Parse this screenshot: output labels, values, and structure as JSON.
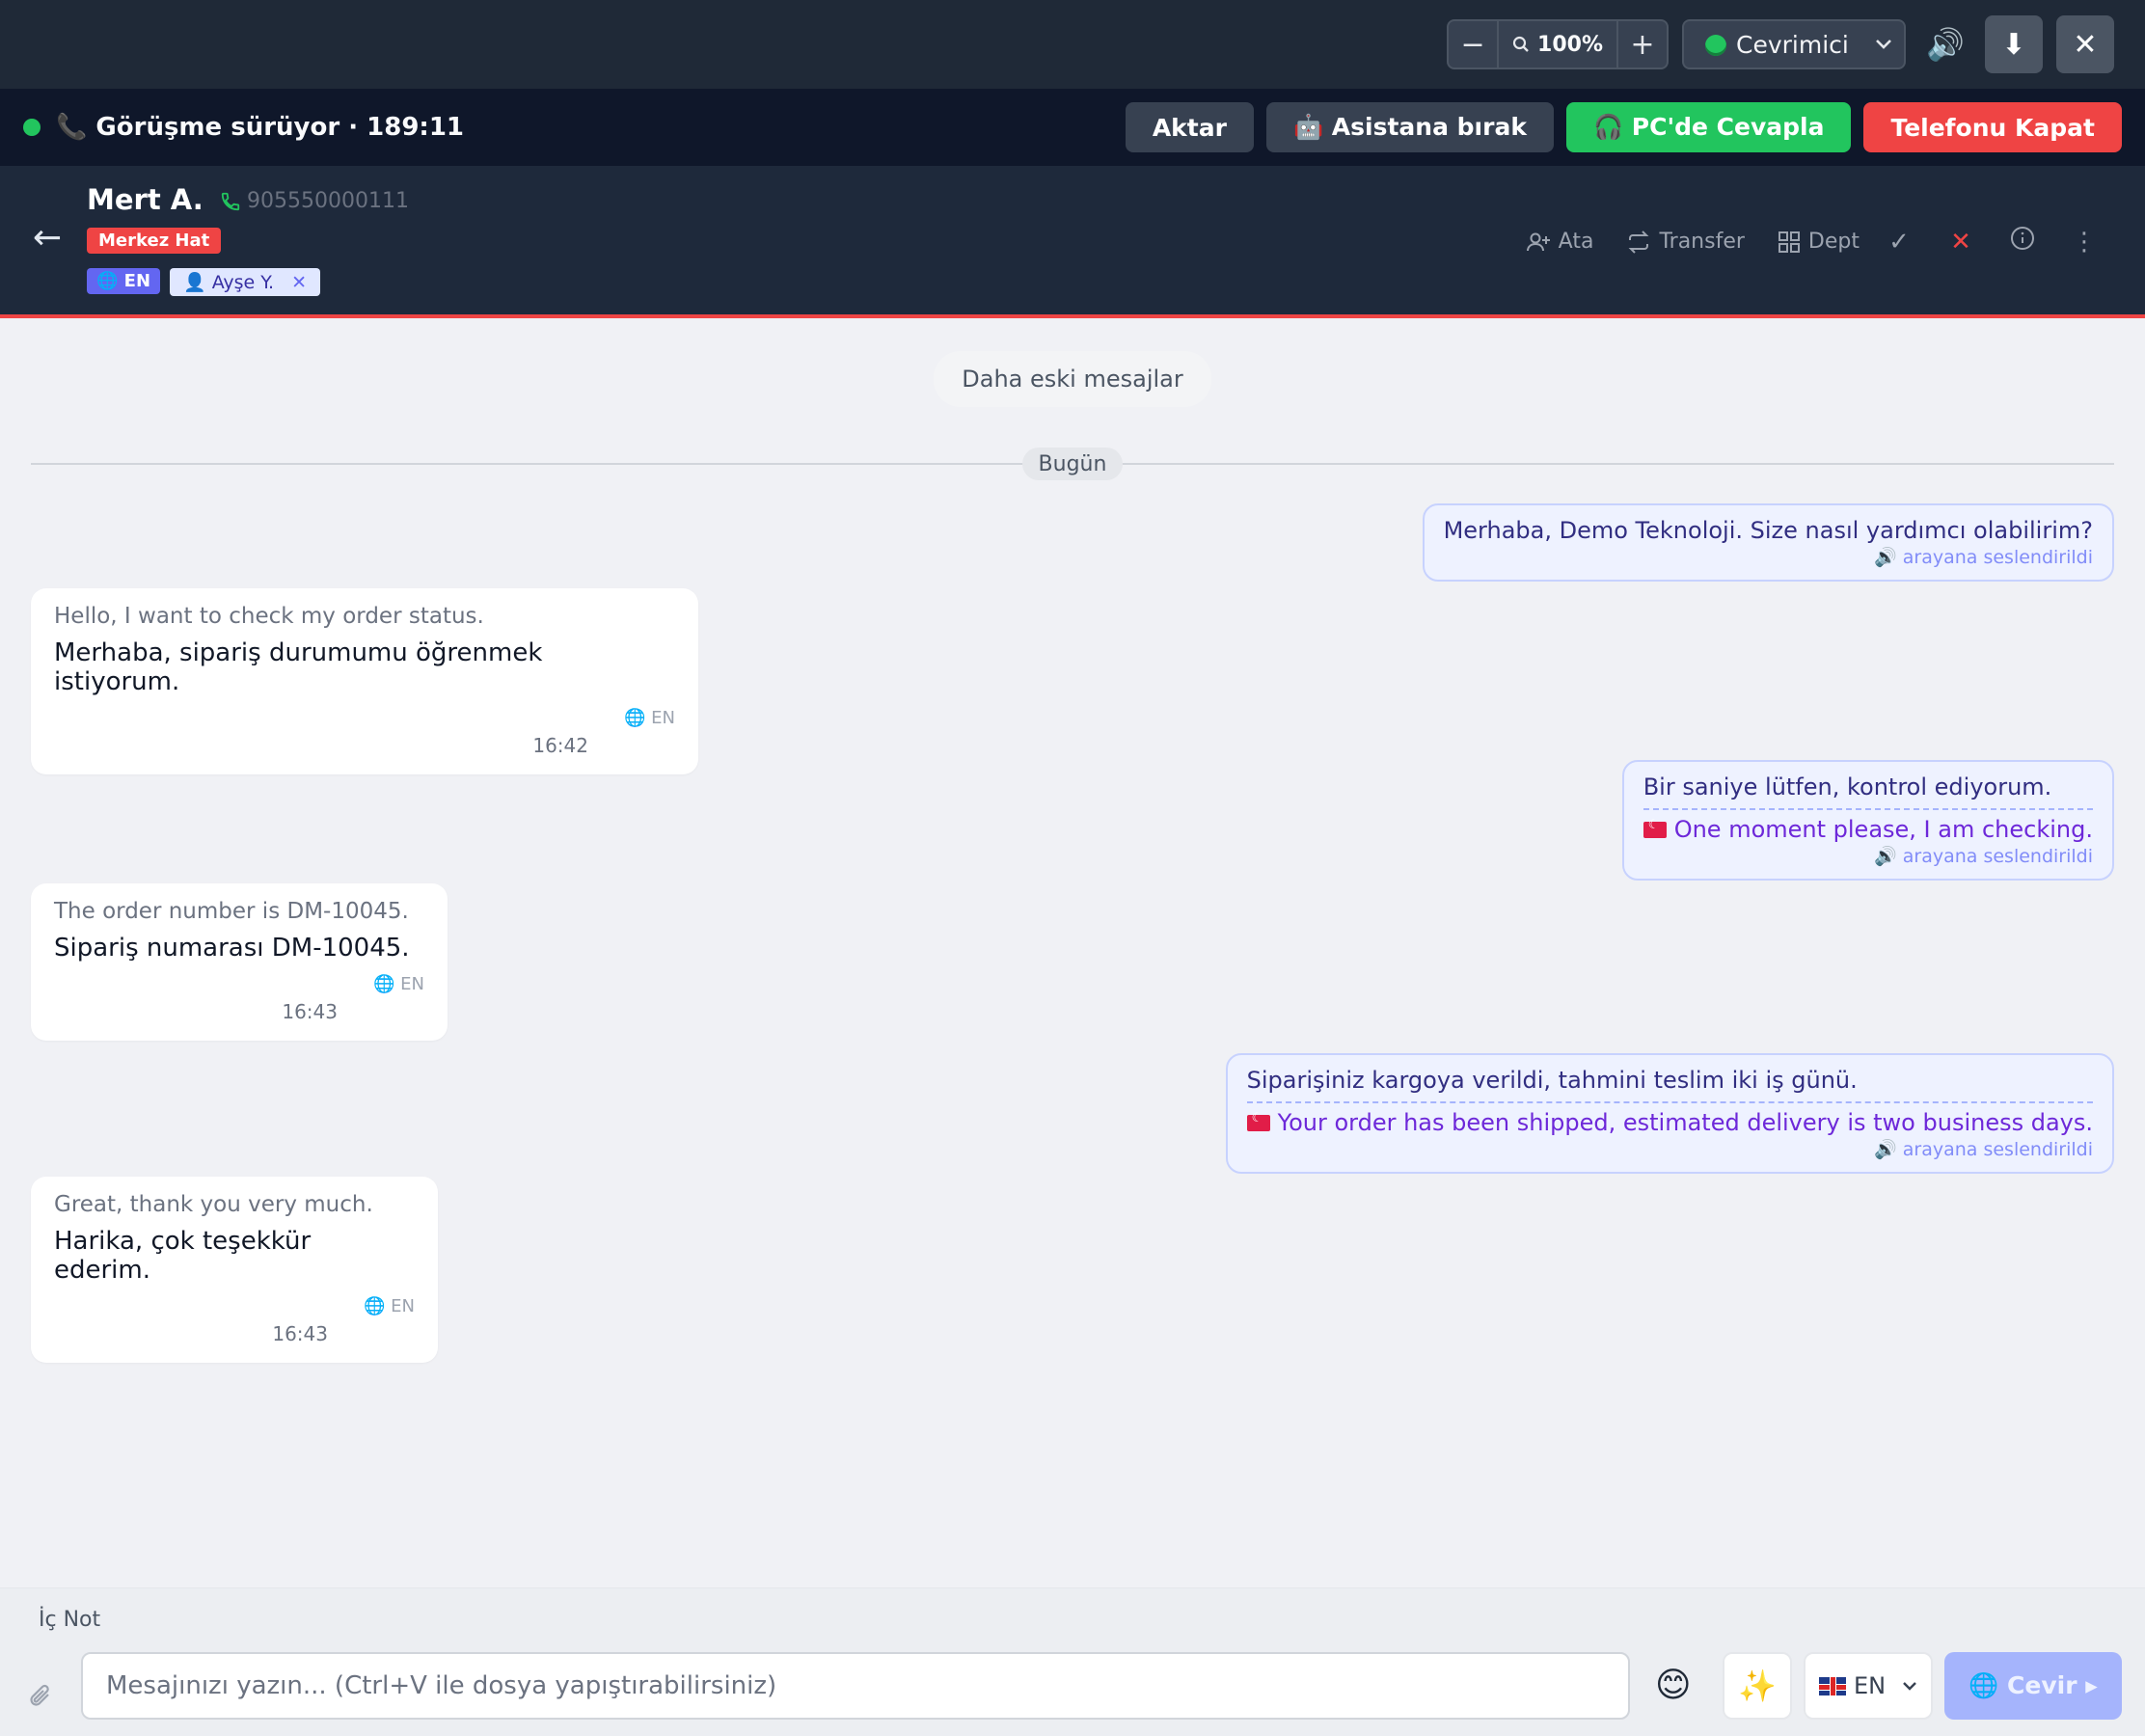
{
  "toolbar": {
    "zoom_minus": "−",
    "zoom_value": "100%",
    "zoom_plus": "+",
    "status_value": "Cevrimici",
    "status_color": "#22c55e",
    "speaker_icon": "🔊",
    "download_icon": "⬇",
    "close_icon": "✕"
  },
  "call": {
    "status_text": "📞 Görüşme sürüyor · 189:11",
    "indicator_color": "#22c55e",
    "actions": {
      "transfer": "Aktar",
      "assistant": "🤖 Asistana bırak",
      "answer_pc": "🎧 PC'de Cevapla",
      "hang_up": "Telefonu Kapat"
    }
  },
  "contact": {
    "name": "Mert A.",
    "phone": "905550000111",
    "line_badge": "Merkez Hat",
    "language_badge": "🌐 EN",
    "agent_badge": "👤 Ayşe Y.",
    "agent_remove": "✕",
    "actions": {
      "assign": "Ata",
      "transfer": "Transfer",
      "dept": "Dept"
    }
  },
  "chat": {
    "older_messages": "Daha eski mesajlar",
    "day_label": "Bugün",
    "messages": [
      {
        "direction": "out",
        "text": "Merhaba, Demo Teknoloji. Size nasıl yardımcı olabilirim?",
        "spoken": "🔊 arayana seslendirildi"
      },
      {
        "direction": "in",
        "original": "Hello, I want to check my order status.",
        "translation": "Merhaba, sipariş durumumu öğrenmek istiyorum.",
        "lang": "EN",
        "time": "16:42"
      },
      {
        "direction": "out",
        "text": "Bir saniye lütfen, kontrol ediyorum.",
        "translation": "One moment please, I am checking.",
        "spoken": "🔊 arayana seslendirildi"
      },
      {
        "direction": "in",
        "original": "The order number is DM-10045.",
        "translation": "Sipariş numarası DM-10045.",
        "lang": "EN",
        "time": "16:43"
      },
      {
        "direction": "out",
        "text": "Siparişiniz kargoya verildi, tahmini teslim iki iş günü.",
        "translation": "Your order has been shipped, estimated delivery is two business days.",
        "spoken": "🔊 arayana seslendirildi"
      },
      {
        "direction": "in",
        "original": "Great, thank you very much.",
        "translation": "Harika, çok teşekkür ederim.",
        "lang": "EN",
        "time": "16:43"
      }
    ]
  },
  "composer": {
    "note_label": "İç Not",
    "placeholder": "Mesajınızı yazın... (Ctrl+V ile dosya yapıştırabilirsiniz)",
    "emoji_icon": "😊",
    "magic_icon": "✨",
    "language": "EN",
    "translate_button": "🌐 Cevir ▸"
  }
}
